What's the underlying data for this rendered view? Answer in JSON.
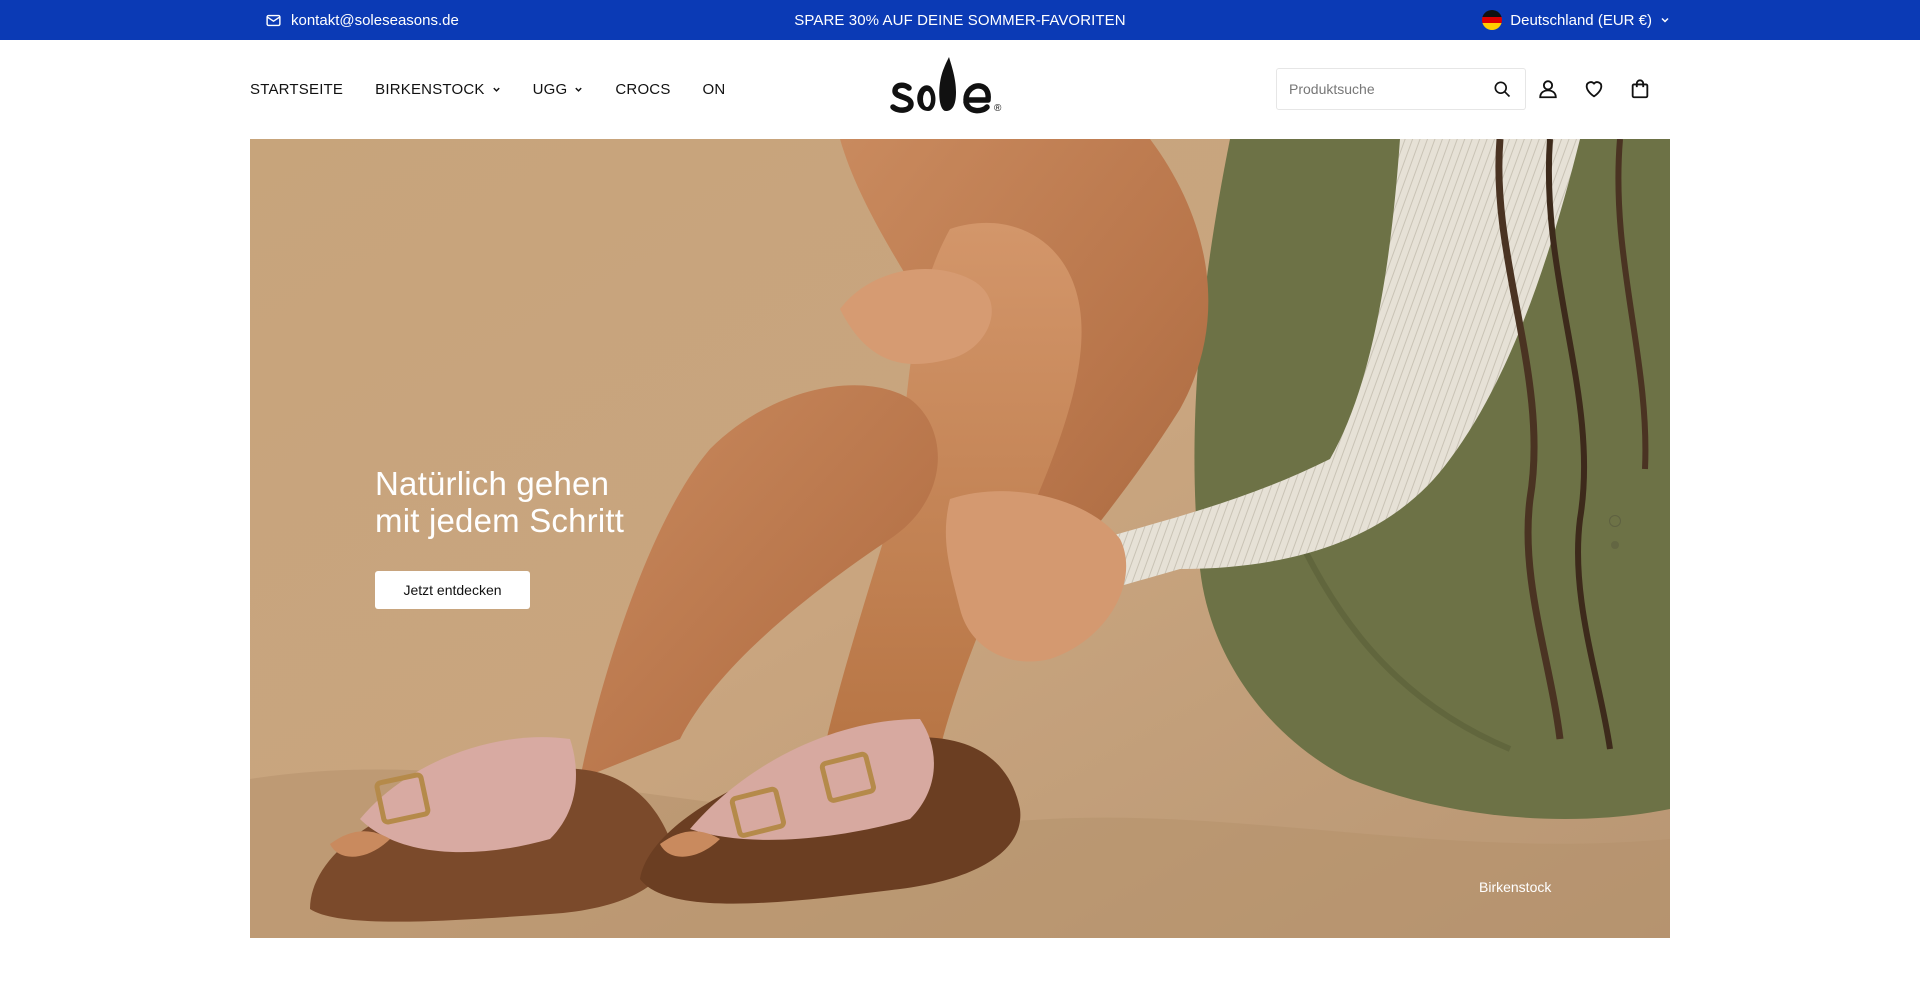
{
  "topbar": {
    "email": "kontakt@soleseasons.de",
    "promo": "SPARE 30% AUF DEINE SOMMER-FAVORITEN",
    "country": "Deutschland (EUR €)",
    "background": "#0b3ab5"
  },
  "nav": {
    "items": [
      {
        "label": "STARTSEITE",
        "dropdown": false
      },
      {
        "label": "BIRKENSTOCK",
        "dropdown": true
      },
      {
        "label": "UGG",
        "dropdown": true
      },
      {
        "label": "CROCS",
        "dropdown": false
      },
      {
        "label": "ON",
        "dropdown": false
      }
    ]
  },
  "logo": {
    "text": "sole",
    "mark": "®"
  },
  "search": {
    "placeholder": "Produktsuche"
  },
  "header_icons": [
    "account-icon",
    "wishlist-heart-icon",
    "cart-bag-icon"
  ],
  "hero": {
    "title_line1": "Natürlich gehen",
    "title_line2": "mit jedem Schritt",
    "button": "Jetzt entdecken",
    "caption": "Birkenstock",
    "slides": 2,
    "active_slide": 1
  }
}
